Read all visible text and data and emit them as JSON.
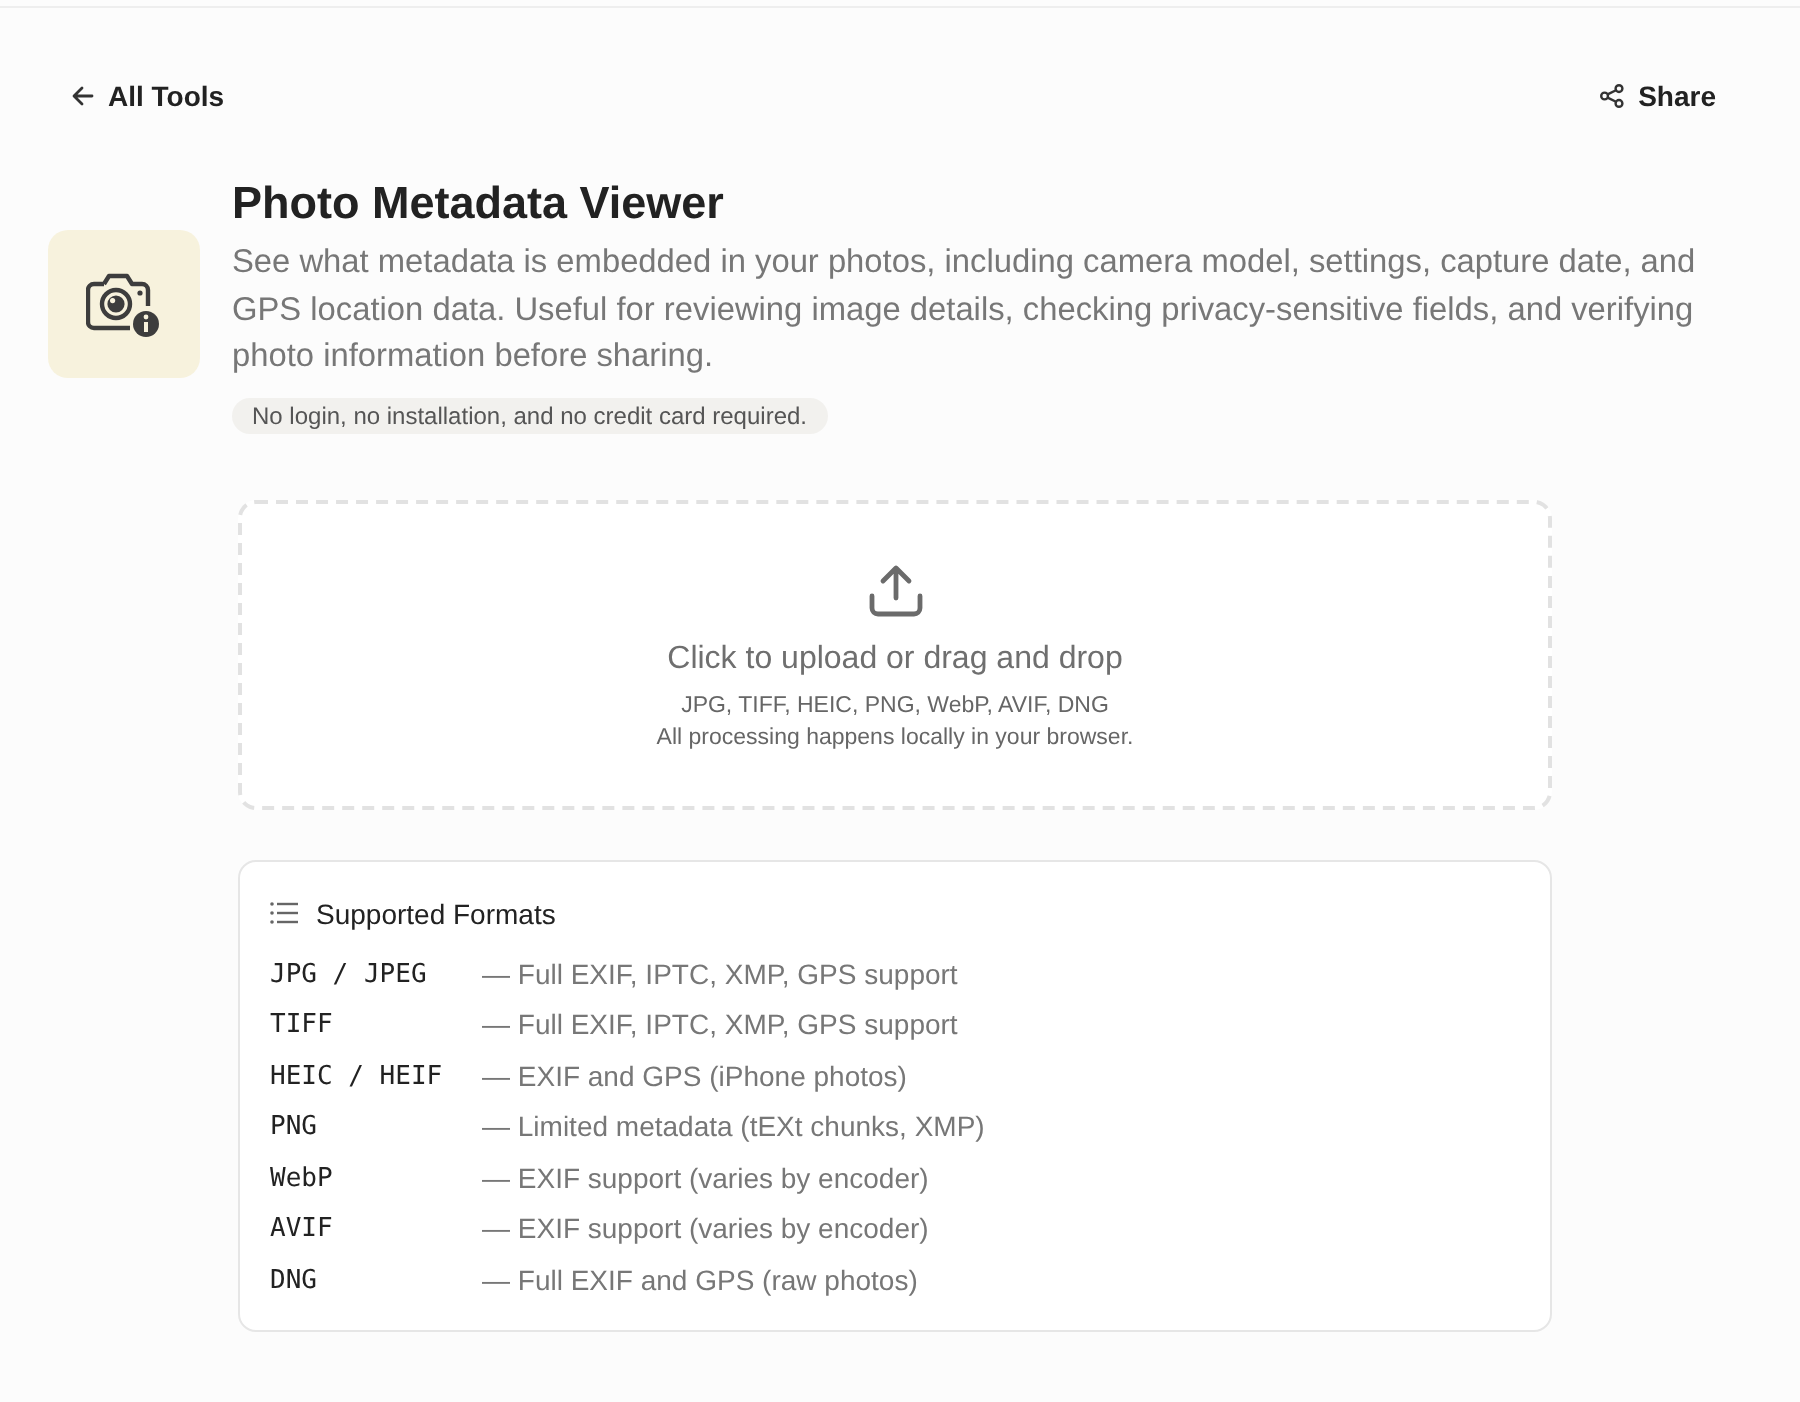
{
  "nav": {
    "back_link": "All Tools",
    "share_button": "Share"
  },
  "tool": {
    "title": "Photo Metadata Viewer",
    "description": "See what metadata is embedded in your photos, including camera model, settings, capture date, and GPS location data. Useful for reviewing image details, checking privacy-sensitive fields, and verifying photo information before sharing.",
    "badge": "No login, no installation, and no credit card required."
  },
  "upload": {
    "prompt": "Click to upload or drag and drop",
    "formats": "JPG, TIFF, HEIC, PNG, WebP, AVIF, DNG",
    "note": "All processing happens locally in your browser."
  },
  "supported_formats": {
    "title": "Supported Formats",
    "rows": [
      {
        "format": "JPG / JPEG",
        "details": "— Full EXIF, IPTC, XMP, GPS support"
      },
      {
        "format": "TIFF",
        "details": "— Full EXIF, IPTC, XMP, GPS support"
      },
      {
        "format": "HEIC / HEIF",
        "details": "— EXIF and GPS (iPhone photos)"
      },
      {
        "format": "PNG",
        "details": "— Limited metadata (tEXt chunks, XMP)"
      },
      {
        "format": "WebP",
        "details": "— EXIF support (varies by encoder)"
      },
      {
        "format": "AVIF",
        "details": "— EXIF support (varies by encoder)"
      },
      {
        "format": "DNG",
        "details": "— Full EXIF and GPS (raw photos)"
      }
    ]
  }
}
